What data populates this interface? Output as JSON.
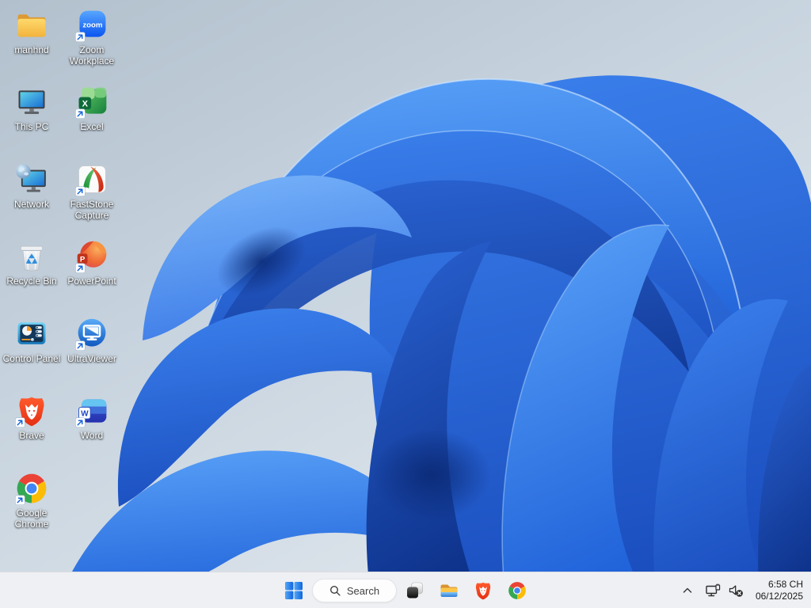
{
  "desktop": {
    "icons": [
      {
        "id": "manhnd",
        "label": "manhnd"
      },
      {
        "id": "zoom-workplace",
        "label": "Zoom Workplace",
        "icon_text": "zoom"
      },
      {
        "id": "this-pc",
        "label": "This PC"
      },
      {
        "id": "excel",
        "label": "Excel",
        "icon_text": "X"
      },
      {
        "id": "network",
        "label": "Network"
      },
      {
        "id": "faststone-capture",
        "label": "FastStone Capture"
      },
      {
        "id": "recycle-bin",
        "label": "Recycle Bin"
      },
      {
        "id": "powerpoint",
        "label": "PowerPoint",
        "icon_text": "P"
      },
      {
        "id": "control-panel",
        "label": "Control Panel"
      },
      {
        "id": "ultraviewer",
        "label": "UltraViewer"
      },
      {
        "id": "brave",
        "label": "Brave"
      },
      {
        "id": "word",
        "label": "Word",
        "icon_text": "W"
      },
      {
        "id": "google-chrome",
        "label": "Google Chrome"
      }
    ]
  },
  "taskbar": {
    "search": {
      "label": "Search",
      "icon": "search-icon"
    },
    "buttons": [
      {
        "icon": "start-icon"
      },
      {
        "icon": "task-view-icon"
      },
      {
        "icon": "file-explorer-icon"
      },
      {
        "icon": "brave-icon"
      },
      {
        "icon": "chrome-icon"
      }
    ],
    "tray": {
      "icons": [
        "chevron-up-icon",
        "network-wired-icon",
        "volume-muted-icon"
      ],
      "time": "6:58 CH",
      "date": "06/12/2025"
    }
  },
  "colors": {
    "taskbar_bg": "#eef0f3",
    "wallpaper_sky": "#c3d0db",
    "bloom_bright": "#4f9cf7",
    "bloom_mid": "#2f74e4",
    "bloom_deep": "#12409e",
    "accent_blue": "#0b5cff"
  }
}
